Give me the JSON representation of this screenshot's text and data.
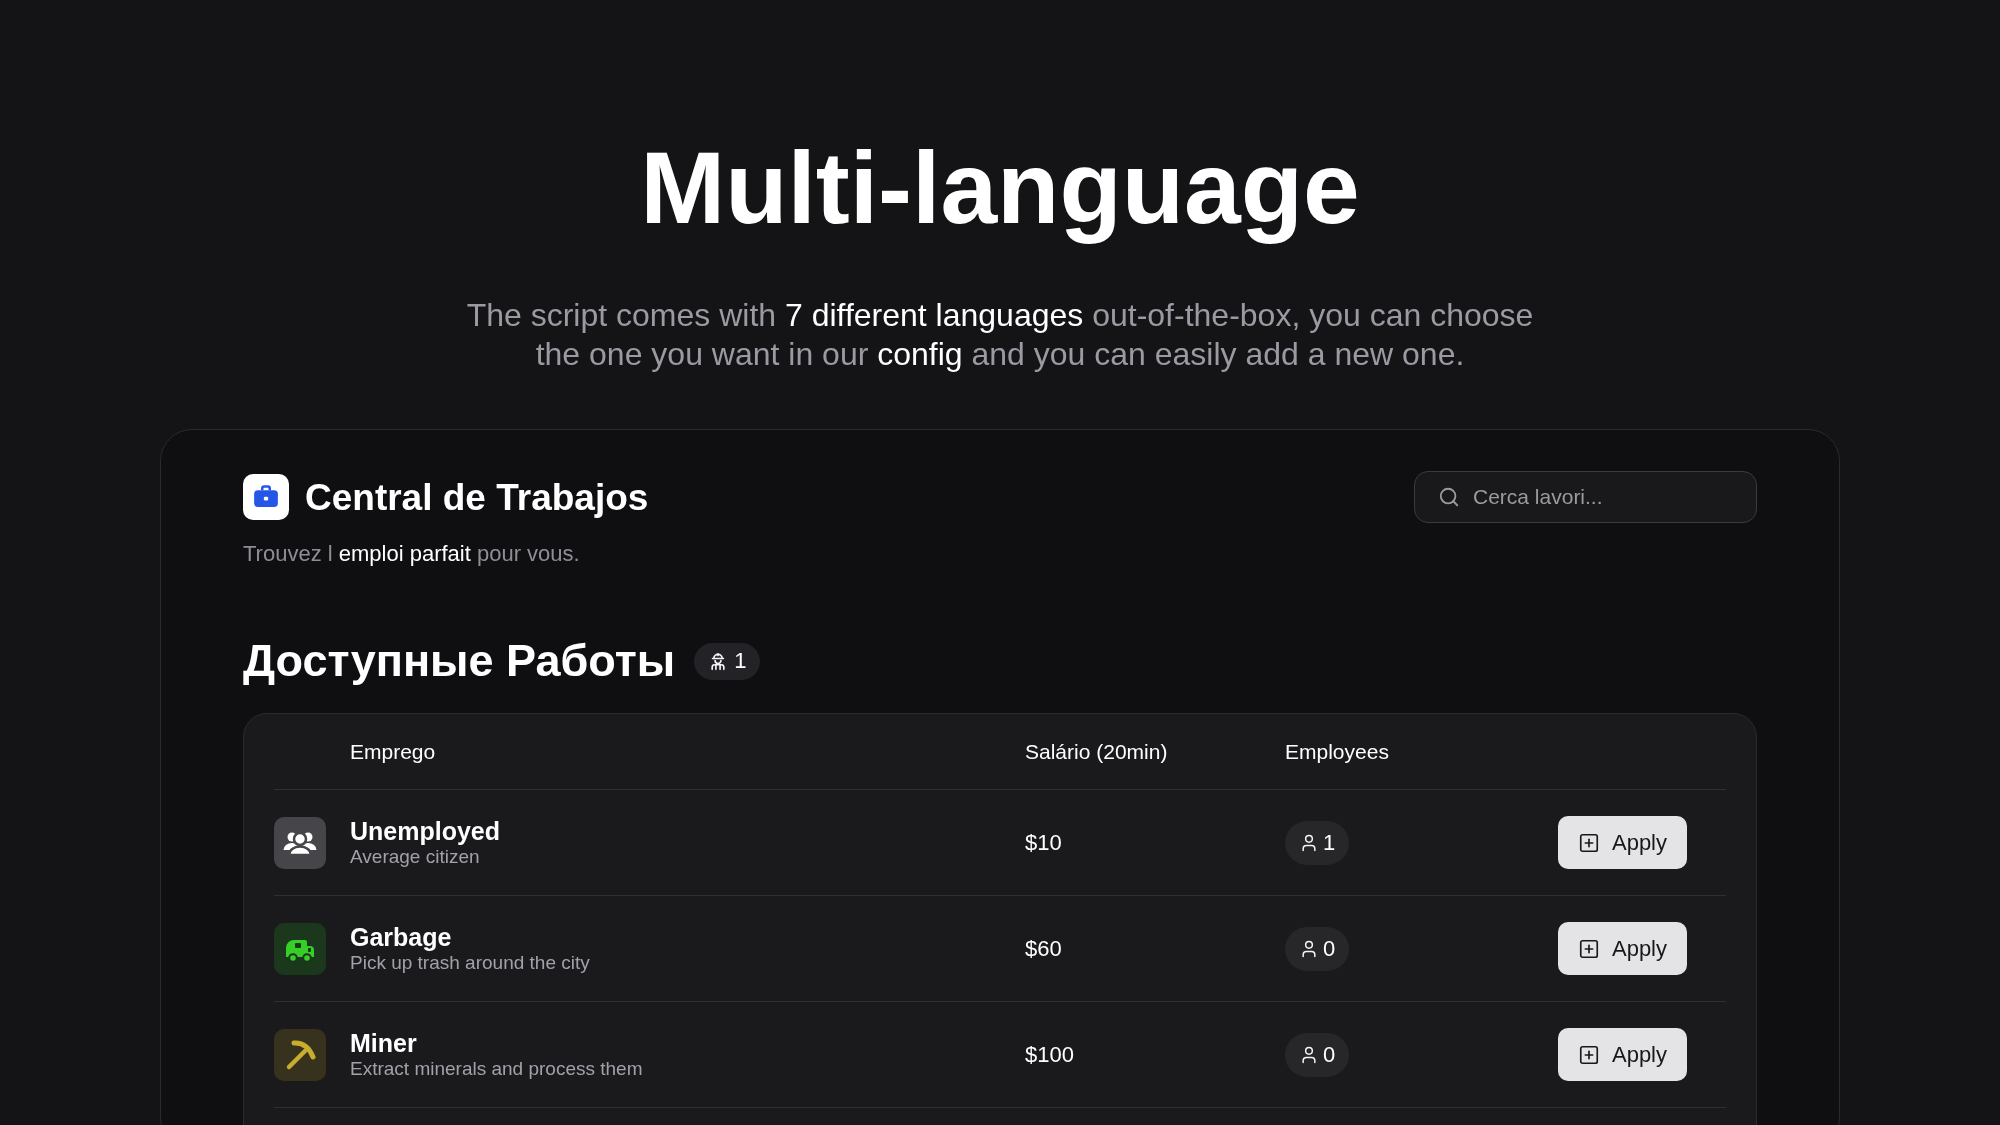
{
  "hero": {
    "title": "Multi-language",
    "subtitle": "The script comes with **7 different languages** out-of-the-box, you can choose the one you want in our **config** and you can easily add a new one."
  },
  "app": {
    "title": "Central de Trabajos",
    "tagline": "Trouvez l **emploi parfait** pour vous.",
    "search": {
      "placeholder": "Cerca lavori..."
    },
    "jobs_heading": "Доступные Работы",
    "jobs_count": "1",
    "table": {
      "columns": [
        "Emprego",
        "Salário (20min)",
        "Employees"
      ],
      "rows": [
        {
          "name": "Unemployed",
          "description": "Average citizen",
          "salary": "$10",
          "employees": "1",
          "color": "#45454a",
          "action": "Apply"
        },
        {
          "name": "Garbage",
          "description": "Pick up trash around the city",
          "salary": "$60",
          "employees": "0",
          "color": "#1c381c",
          "action": "Apply"
        },
        {
          "name": "Miner",
          "description": "Extract minerals and process them",
          "salary": "$100",
          "employees": "0",
          "color": "#37321d",
          "action": "Apply"
        }
      ]
    }
  }
}
